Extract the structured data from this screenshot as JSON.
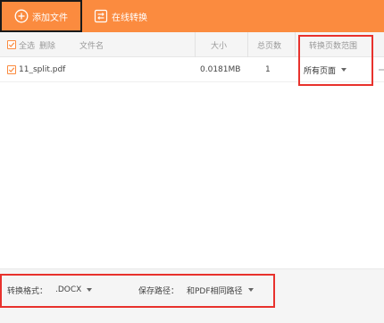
{
  "toolbar": {
    "add_file_label": "添加文件",
    "online_convert_label": "在线转换",
    "accent": "#fb8b3f"
  },
  "table": {
    "headers": {
      "select_all": "全选",
      "delete": "删除",
      "filename": "文件名",
      "size": "大小",
      "total_pages": "总页数",
      "page_range": "转换页数范围"
    },
    "rows": [
      {
        "filename": "11_split.pdf",
        "size": "0.0181MB",
        "pages": "1",
        "range": "所有页面",
        "checked": true
      }
    ]
  },
  "footer": {
    "format_label": "转换格式：",
    "format_value": ".DOCX",
    "save_path_label": "保存路径：",
    "save_path_value": "和PDF相同路径"
  },
  "highlight_color": "#e8322d"
}
